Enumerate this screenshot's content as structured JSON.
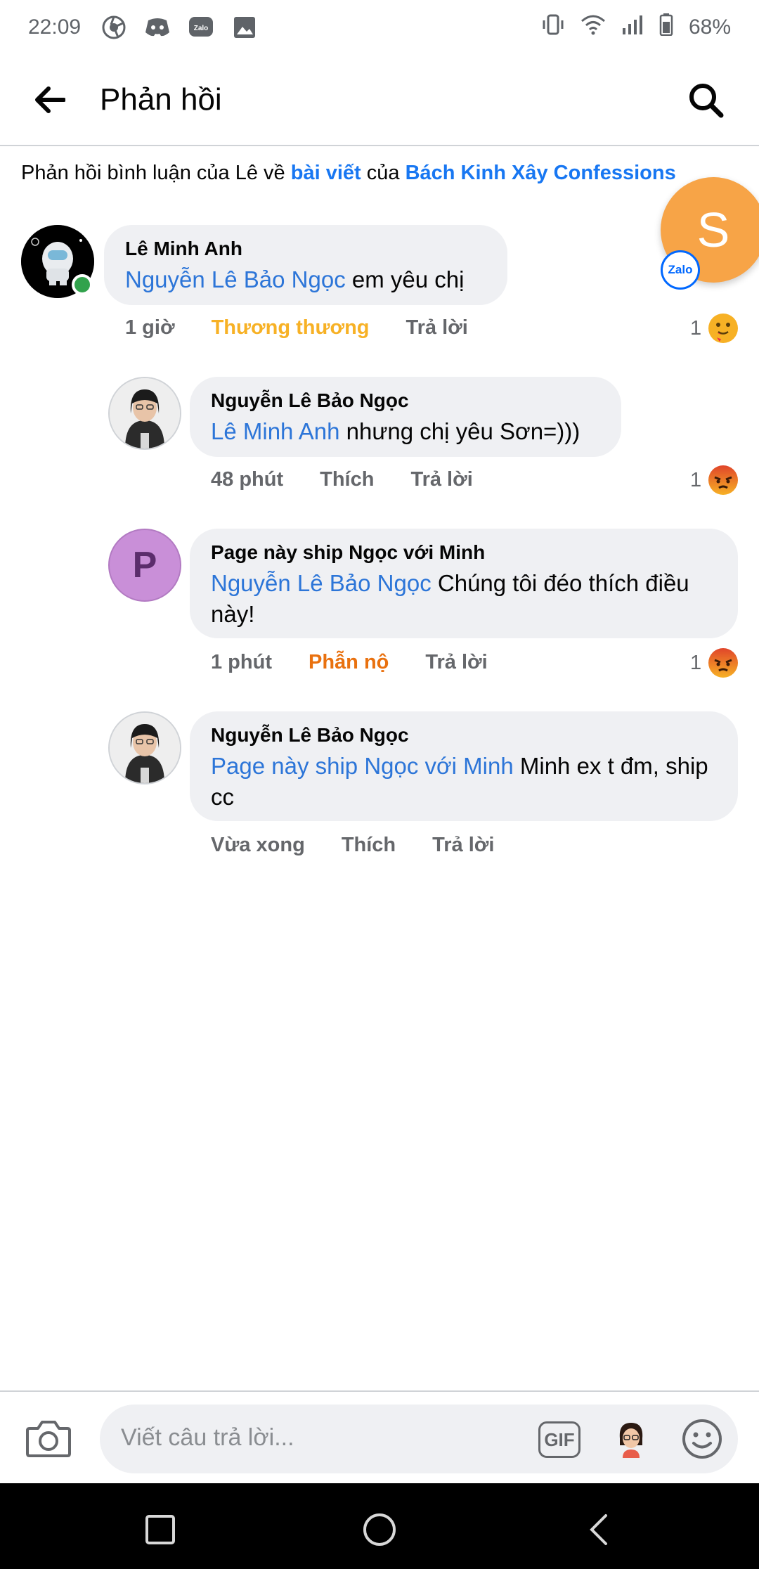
{
  "status_bar": {
    "time": "22:09",
    "battery": "68%",
    "app_icons": [
      "chrome-like-icon",
      "discord-icon",
      "zalo-icon",
      "gallery-icon"
    ],
    "zalo_text": "Zalo"
  },
  "header": {
    "title": "Phản hồi"
  },
  "context": {
    "prefix": "Phản hồi bình luận của Lê về ",
    "post_link": "bài viết",
    "middle": " của ",
    "page_link": "Bách Kinh Xây Confessions"
  },
  "chat_head": {
    "initial": "S",
    "badge": "Zalo"
  },
  "comments": [
    {
      "author": "Lê Minh Anh",
      "mention": "Nguyễn Lê Bảo Ngọc",
      "text": " em yêu chị",
      "time": "1 giờ",
      "reaction_label": "Thương thương",
      "reply_label": "Trả lời",
      "reaction_count": "1",
      "reaction_color": "#f7b125"
    },
    {
      "author": "Nguyễn Lê Bảo Ngọc",
      "mention": "Lê Minh Anh",
      "text": " nhưng chị yêu Sơn=)))",
      "time": "48 phút",
      "reaction_label": "Thích",
      "reply_label": "Trả lời",
      "reaction_count": "1",
      "reaction_color": "#e9710f"
    },
    {
      "author": "Page này ship Ngọc với Minh",
      "avatar_letter": "P",
      "mention": "Nguyễn Lê Bảo Ngọc",
      "text": " Chúng tôi đéo thích điều này!",
      "time": "1 phút",
      "reaction_label": "Phẫn nộ",
      "reply_label": "Trả lời",
      "reaction_count": "1",
      "reaction_color": "#e9710f"
    },
    {
      "author": "Nguyễn Lê Bảo Ngọc",
      "mention": "Page này ship Ngọc với Minh",
      "text": " Minh ex t đm, ship cc",
      "time": "Vừa xong",
      "reaction_label": "Thích",
      "reply_label": "Trả lời"
    }
  ],
  "composer": {
    "placeholder": "Viết câu trả lời...",
    "gif_label": "GIF"
  },
  "colors": {
    "link": "#1877f2",
    "mention": "#2c75d8",
    "bubble": "#eff0f3",
    "love_reaction": "#f7b125",
    "angry_reaction": "#e9710f"
  }
}
